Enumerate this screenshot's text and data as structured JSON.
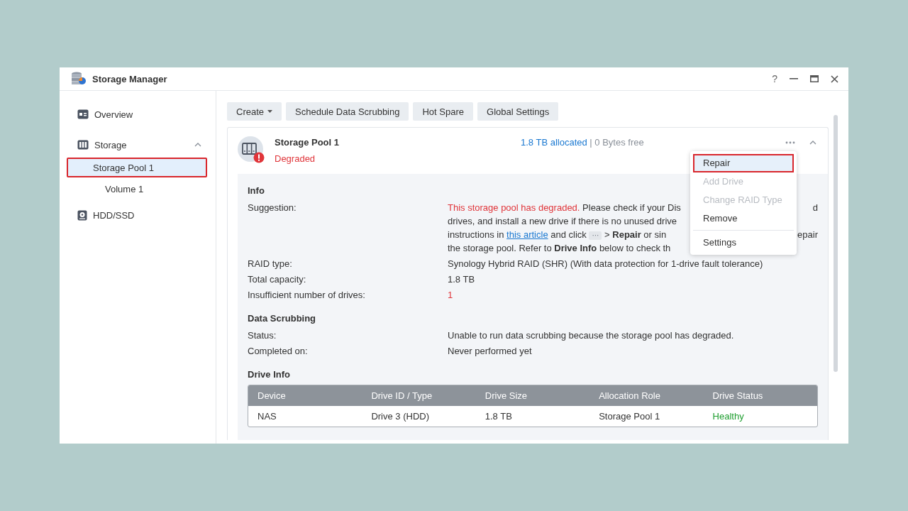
{
  "window": {
    "title": "Storage Manager",
    "help": "?"
  },
  "sidebar": {
    "items": [
      {
        "label": "Overview",
        "selected": false
      },
      {
        "label": "Storage",
        "selected": false,
        "expanded": true,
        "children": [
          {
            "label": "Storage Pool 1",
            "selected": true
          },
          {
            "label": "Volume 1",
            "selected": false
          }
        ]
      },
      {
        "label": "HDD/SSD",
        "selected": false
      }
    ]
  },
  "toolbar": [
    {
      "label": "Create",
      "dropdown": true
    },
    {
      "label": "Schedule Data Scrubbing",
      "dropdown": false
    },
    {
      "label": "Hot Spare",
      "dropdown": false
    },
    {
      "label": "Global Settings",
      "dropdown": false
    }
  ],
  "pool": {
    "name": "Storage Pool 1",
    "status": "Degraded",
    "allocated": "1.8 TB allocated",
    "separator": "|",
    "free": "0 Bytes free",
    "expanded": true,
    "menu": [
      {
        "label": "Repair",
        "disabled": false,
        "highlighted": true
      },
      {
        "label": "Add Drive",
        "disabled": true,
        "highlighted": false
      },
      {
        "label": "Change RAID Type",
        "disabled": true,
        "highlighted": false
      },
      {
        "label": "Remove",
        "disabled": false,
        "highlighted": false
      },
      {
        "label": "Settings",
        "disabled": false,
        "highlighted": false
      }
    ],
    "info": {
      "heading": "Info",
      "suggestion_label": "Suggestion:",
      "suggestion_lines": [
        {
          "segments": [
            {
              "kind": "alert",
              "text": "This storage pool has degraded."
            },
            {
              "kind": "text",
              "text": " Please check if your Dis"
            }
          ],
          "right": "d"
        },
        {
          "segments": [
            {
              "kind": "text",
              "text": "drives, and install a new drive if there is no unused drive"
            }
          ]
        },
        {
          "segments": [
            {
              "kind": "text",
              "text": "instructions in "
            },
            {
              "kind": "link",
              "text": "this article"
            },
            {
              "kind": "text",
              "text": " and click "
            },
            {
              "kind": "chip",
              "text": "···"
            },
            {
              "kind": "text",
              "text": " > **Repair** or sin"
            }
          ],
          "right": "epair"
        },
        {
          "segments": [
            {
              "kind": "text",
              "text": "the storage pool. Refer to **Drive Info** below to check th"
            }
          ]
        }
      ],
      "rows": [
        {
          "label": "RAID type:",
          "value": "Synology Hybrid RAID (SHR) (With data protection for 1-drive fault tolerance)",
          "alert": false
        },
        {
          "label": "Total capacity:",
          "value": "1.8 TB",
          "alert": false
        },
        {
          "label": "Insufficient number of drives:",
          "value": "1",
          "alert": true
        }
      ]
    },
    "scrubbing": {
      "heading": "Data Scrubbing",
      "rows": [
        {
          "label": "Status:",
          "value": "Unable to run data scrubbing because the storage pool has degraded.",
          "alert": false
        },
        {
          "label": "Completed on:",
          "value": "Never performed yet",
          "alert": false
        }
      ]
    },
    "drives": {
      "heading": "Drive Info",
      "columns": [
        "Device",
        "Drive ID / Type",
        "Drive Size",
        "Allocation Role",
        "Drive Status"
      ],
      "rows": [
        {
          "cells": [
            "NAS",
            "Drive 3 (HDD)",
            "1.8 TB",
            "Storage Pool 1",
            "Healthy"
          ],
          "healthy": true
        }
      ]
    }
  }
}
